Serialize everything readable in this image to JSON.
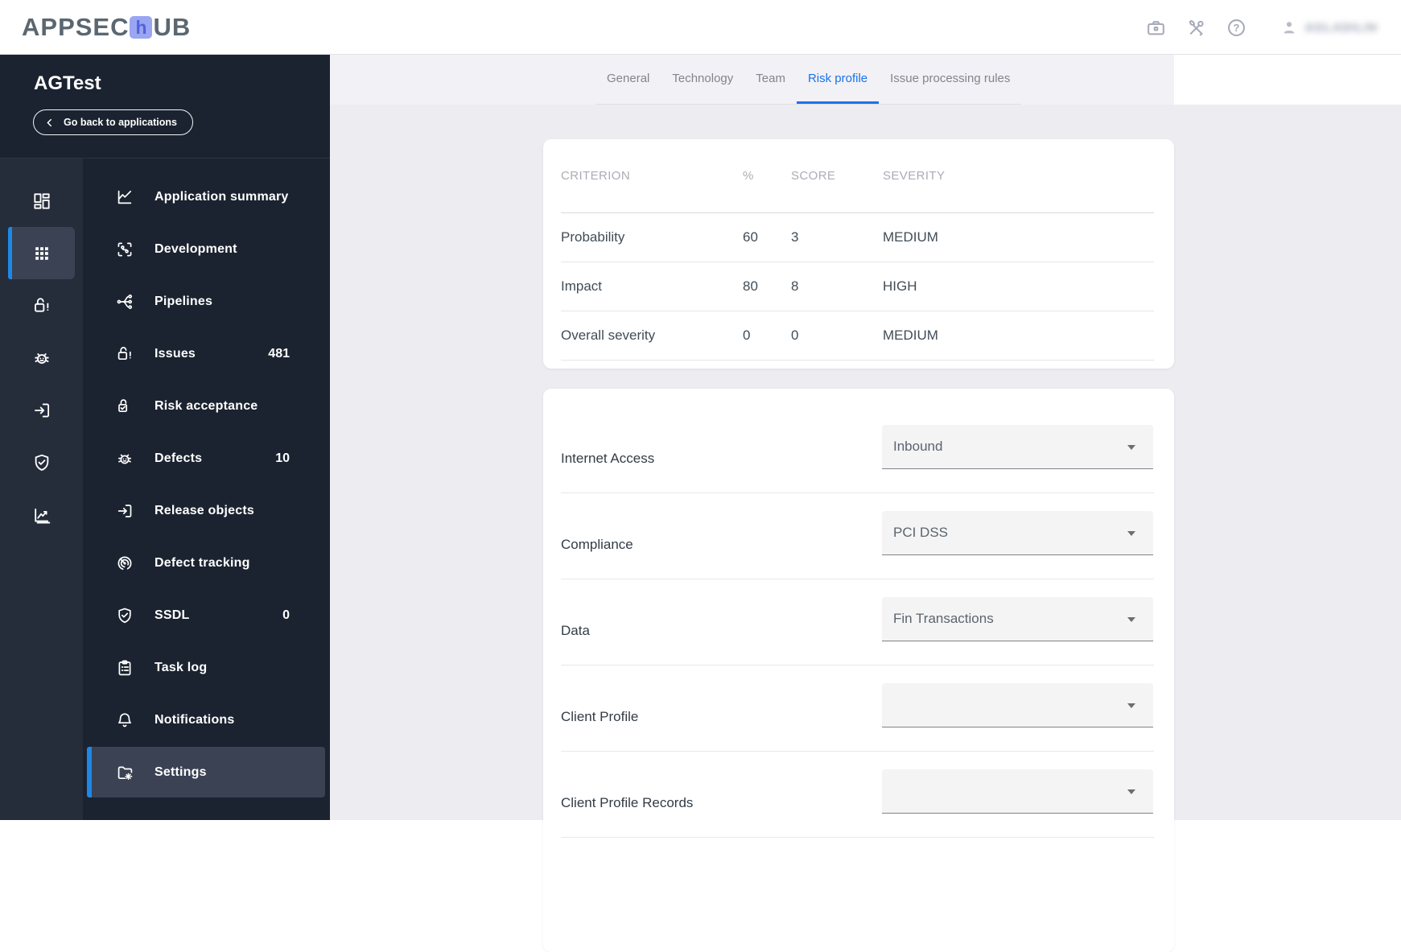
{
  "header": {
    "logo_pre": "APPSEC",
    "logo_tile": "h",
    "logo_post": "UB",
    "username": "AGLADILIN"
  },
  "sidebar": {
    "app_name": "AGTest",
    "back_label": "Go back to applications",
    "menu": [
      {
        "label": "Application summary",
        "count": ""
      },
      {
        "label": "Development",
        "count": ""
      },
      {
        "label": "Pipelines",
        "count": ""
      },
      {
        "label": "Issues",
        "count": "481"
      },
      {
        "label": "Risk acceptance",
        "count": ""
      },
      {
        "label": "Defects",
        "count": "10"
      },
      {
        "label": "Release objects",
        "count": ""
      },
      {
        "label": "Defect tracking",
        "count": ""
      },
      {
        "label": "SSDL",
        "count": "0"
      },
      {
        "label": "Task log",
        "count": ""
      },
      {
        "label": "Notifications",
        "count": ""
      },
      {
        "label": "Settings",
        "count": ""
      }
    ]
  },
  "tabs": [
    {
      "label": "General"
    },
    {
      "label": "Technology"
    },
    {
      "label": "Team"
    },
    {
      "label": "Risk profile"
    },
    {
      "label": "Issue processing rules"
    }
  ],
  "risk_table": {
    "columns": [
      "CRITERION",
      "%",
      "SCORE",
      "SEVERITY"
    ],
    "rows": [
      {
        "criterion": "Probability",
        "percent": "60",
        "score": "3",
        "severity": "MEDIUM"
      },
      {
        "criterion": "Impact",
        "percent": "80",
        "score": "8",
        "severity": "HIGH"
      },
      {
        "criterion": "Overall severity",
        "percent": "0",
        "score": "0",
        "severity": "MEDIUM"
      }
    ]
  },
  "profile_form": {
    "fields": [
      {
        "label": "Internet Access",
        "value": "Inbound"
      },
      {
        "label": "Compliance",
        "value": "PCI DSS"
      },
      {
        "label": "Data",
        "value": "Fin Transactions"
      },
      {
        "label": "Client Profile",
        "value": ""
      },
      {
        "label": "Client Profile Records",
        "value": ""
      }
    ]
  },
  "colors": {
    "accent_blue": "#1e88e5",
    "active_tab_blue": "#1a73e8",
    "sidebar_bg": "#1b2330",
    "rail_bg": "#252d3b",
    "selected_row_bg": "#3a4254",
    "logo_tile_bg": "#9aa6f1",
    "page_bg": "#edecf1"
  }
}
